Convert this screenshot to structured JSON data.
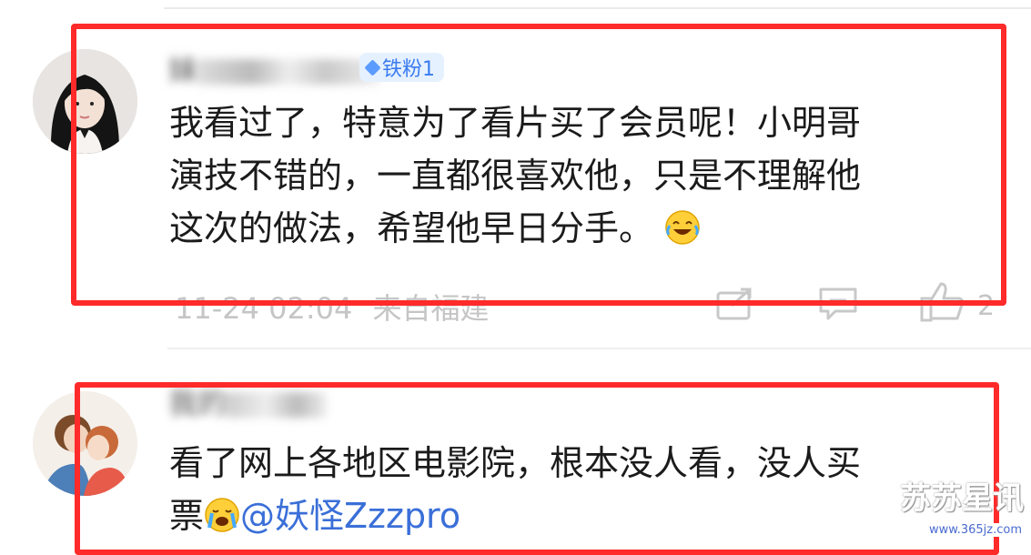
{
  "comments": [
    {
      "username": "妹",
      "badge": "铁粉1",
      "text_lines": [
        "我看过了，特意为了看片买了会员呢！小明哥",
        "演技不错的，一直都很喜欢他，只是不理解他",
        "这次的做法，希望他早日分手。"
      ],
      "emoji": "laugh-cry-emoji",
      "timestamp": "11-24 02:04",
      "location": "来自福建",
      "like_count": "2"
    },
    {
      "username": "我的",
      "text_lines": [
        "看了网上各地区电影院，根本没人看，没人买"
      ],
      "text_line2_prefix": "票",
      "emoji": "crying-emoji",
      "mention": "@妖怪Zzzpro"
    }
  ],
  "watermark": {
    "title": "苏苏星讯",
    "url": "www.365jz.com"
  },
  "colors": {
    "highlight_box": "#ff2a2a",
    "badge_text": "#3a7cf0",
    "mention": "#3a6fd8"
  }
}
